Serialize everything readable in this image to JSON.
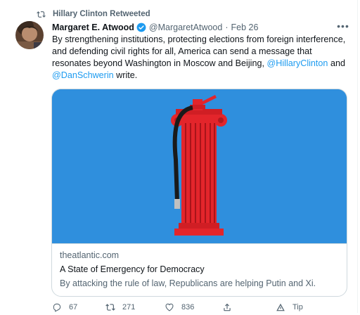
{
  "retweet": {
    "icon": "retweet-icon",
    "label": "Hillary Clinton Retweeted"
  },
  "tweet": {
    "author_name": "Margaret E. Atwood",
    "verified_icon": "verified-badge-icon",
    "handle": "@MargaretAtwood",
    "separator": "·",
    "date": "Feb 26",
    "more_icon": "more-options-icon",
    "more_label": "•••",
    "text_part1": "By strengthening institutions, protecting elections from foreign interference, and defending civil rights for all, America can send a message that resonates beyond Washington in Moscow and Beijing, ",
    "mention1": "@HillaryClinton",
    "text_part2": "and ",
    "mention2": "@DanSchwerin",
    "text_part3": " write."
  },
  "card": {
    "domain": "theatlantic.com",
    "title": "A State of Emergency for Democracy",
    "description": "By attacking the rule of law, Republicans are helping Putin and Xi."
  },
  "actions": {
    "reply": {
      "icon": "reply-icon",
      "count": "67"
    },
    "retweet": {
      "icon": "retweet-icon",
      "count": "271"
    },
    "like": {
      "icon": "like-heart-icon",
      "count": "836"
    },
    "share": {
      "icon": "share-icon"
    },
    "tip": {
      "icon": "tip-icon",
      "label": "Tip"
    }
  },
  "colors": {
    "link_blue": "#1d9bf0",
    "secondary_text": "#536471",
    "card_image_bg": "#2f8fdd",
    "column_red": "#e3252b"
  }
}
